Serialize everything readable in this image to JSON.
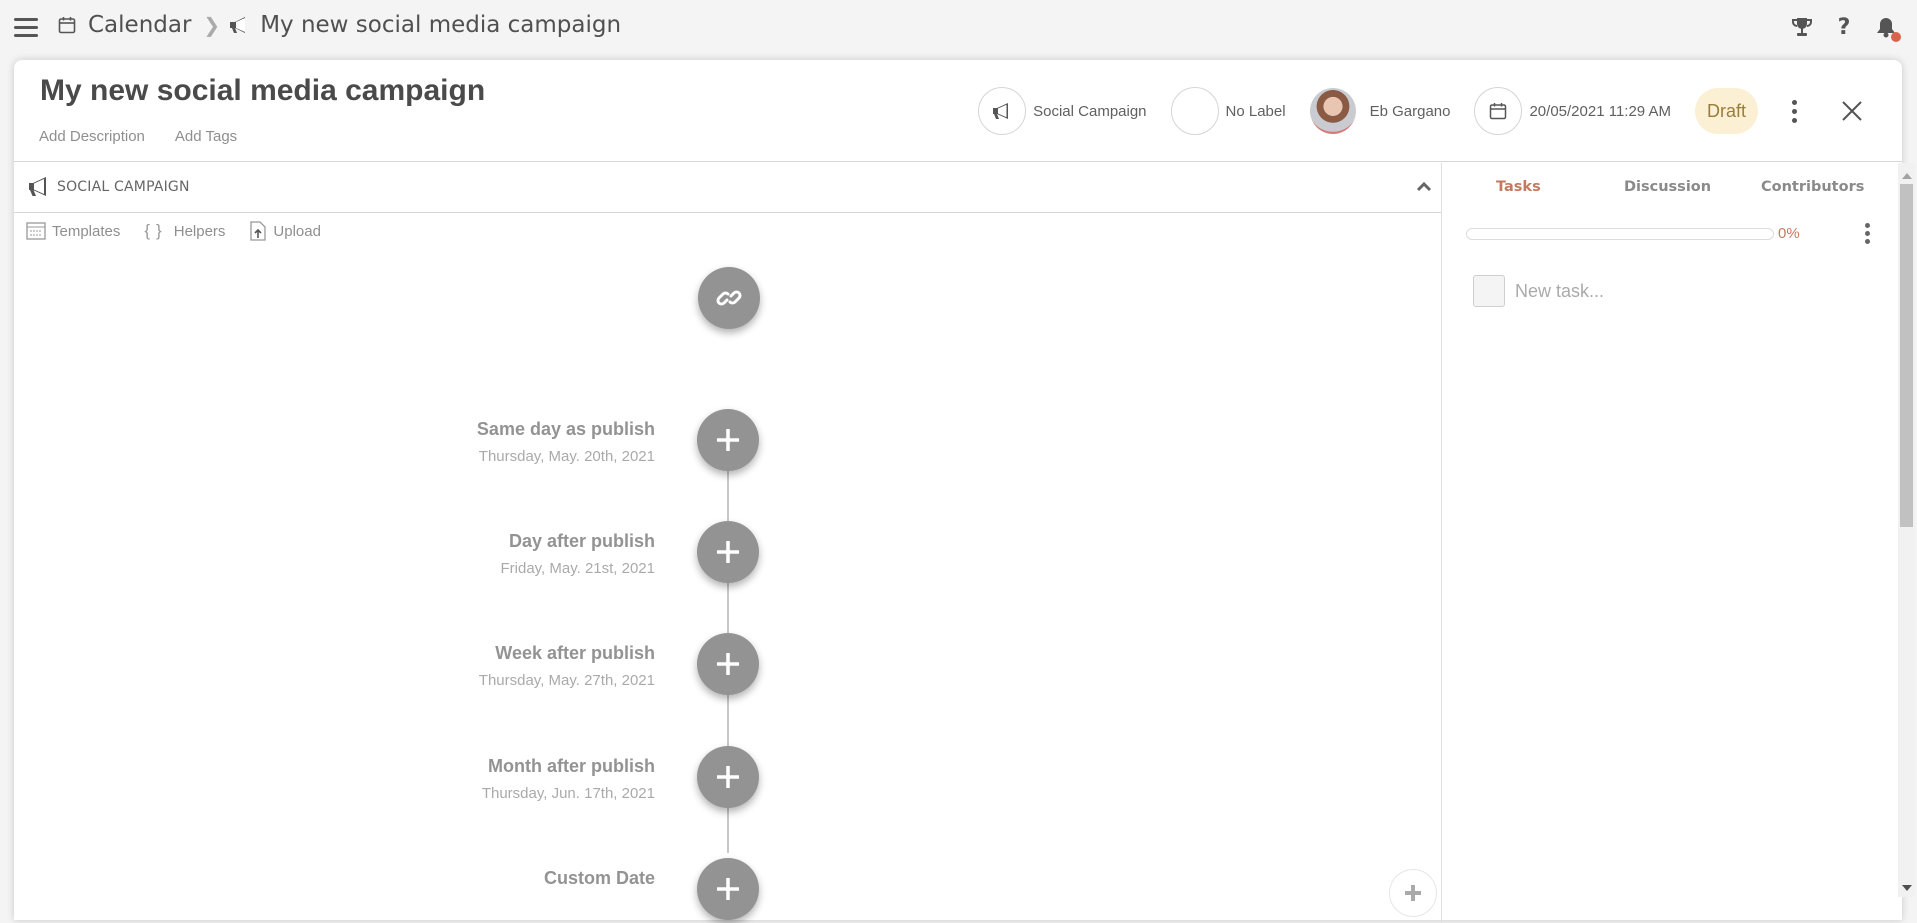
{
  "breadcrumb": {
    "root": "Calendar",
    "current": "My new social media campaign"
  },
  "top_icons": [
    "trophy-icon",
    "help-icon",
    "bell-icon"
  ],
  "header": {
    "title": "My new social media campaign",
    "add_description": "Add Description",
    "add_tags": "Add Tags",
    "type_label": "Social Campaign",
    "label_label": "No Label",
    "owner": "Eb Gargano",
    "datetime": "20/05/2021 11:29 AM",
    "status": "Draft"
  },
  "section": {
    "title": "SOCIAL CAMPAIGN",
    "tools": {
      "templates": "Templates",
      "helpers": "Helpers",
      "upload": "Upload"
    }
  },
  "timeline": [
    {
      "name": "Same day as publish",
      "date": "Thursday, May. 20th, 2021"
    },
    {
      "name": "Day after publish",
      "date": "Friday, May. 21st, 2021"
    },
    {
      "name": "Week after publish",
      "date": "Thursday, May. 27th, 2021"
    },
    {
      "name": "Month after publish",
      "date": "Thursday, Jun. 17th, 2021"
    },
    {
      "name": "Custom Date",
      "date": ""
    }
  ],
  "sidebar": {
    "tabs": [
      {
        "label": "Tasks",
        "active": true
      },
      {
        "label": "Discussion",
        "active": false
      },
      {
        "label": "Contributors",
        "active": false
      }
    ],
    "progress_percent": 0,
    "progress_label": "0%",
    "new_task_placeholder": "New task..."
  },
  "colors": {
    "accent": "#c47a62",
    "draft_bg": "#fbf0d3",
    "node": "#939393",
    "notification_dot": "#d9634c"
  }
}
